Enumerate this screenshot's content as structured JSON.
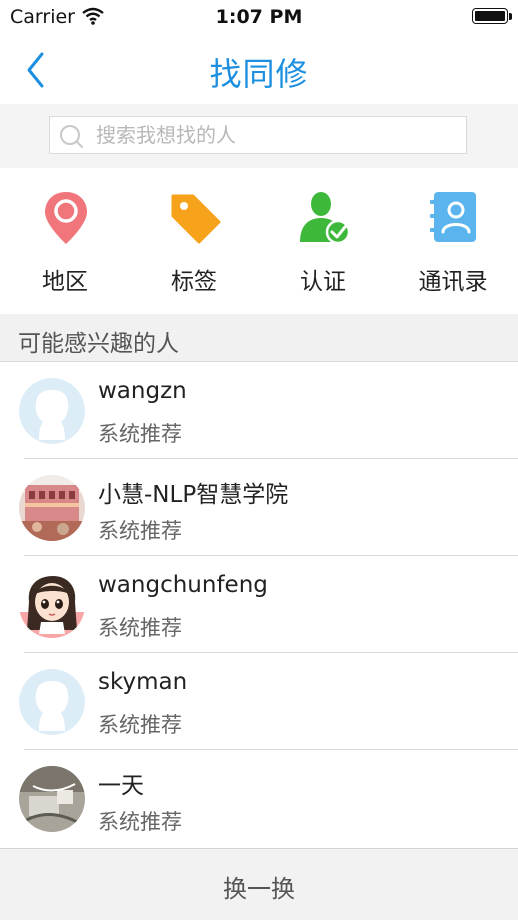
{
  "status_bar": {
    "carrier": "Carrier",
    "time": "1:07 PM"
  },
  "nav": {
    "title": "找同修",
    "back_icon": "chevron-left-icon"
  },
  "search": {
    "placeholder": "搜索我想找的人",
    "value": ""
  },
  "categories": [
    {
      "label": "地区",
      "icon": "location-pin-icon",
      "color": "#f0767c"
    },
    {
      "label": "标签",
      "icon": "tag-icon",
      "color": "#f7a21b"
    },
    {
      "label": "认证",
      "icon": "verified-user-icon",
      "color": "#3db83a"
    },
    {
      "label": "通讯录",
      "icon": "contacts-book-icon",
      "color": "#5bb4ee"
    }
  ],
  "section": {
    "title": "可能感兴趣的人"
  },
  "people": [
    {
      "name": "wangzn",
      "subtitle": "系统推荐",
      "avatar": "default-avatar"
    },
    {
      "name": "小慧-NLP智慧学院",
      "subtitle": "系统推荐",
      "avatar": "photo-building"
    },
    {
      "name": "wangchunfeng",
      "subtitle": "系统推荐",
      "avatar": "cartoon-girl"
    },
    {
      "name": "skyman",
      "subtitle": "系统推荐",
      "avatar": "default-avatar"
    },
    {
      "name": "一天",
      "subtitle": "系统推荐",
      "avatar": "photo-desk"
    }
  ],
  "footer": {
    "refresh_label": "换一换"
  },
  "colors": {
    "accent": "#1c8fe0",
    "default_avatar": "#dcedf8"
  }
}
